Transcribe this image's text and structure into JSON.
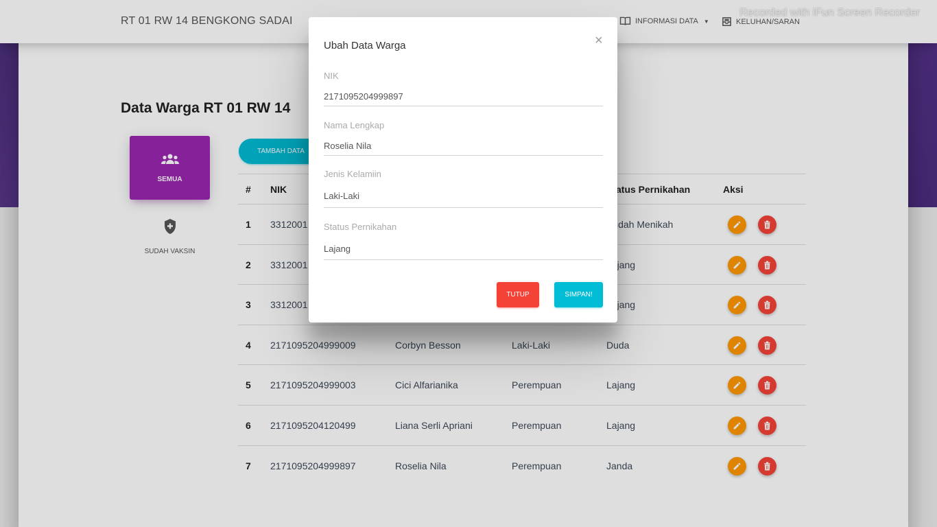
{
  "navbar": {
    "brand": "RT 01 RW 14 BENGKONG SADAI",
    "informasi": "INFORMASI DATA",
    "keluhan": "KELUHAN/SARAN",
    "watermark": "Recorded with iFun Screen Recorder"
  },
  "page": {
    "title": "Data Warga RT 01 RW 14"
  },
  "sidebar": {
    "semua": "SEMUA",
    "vaksin": "SUDAH VAKSIN"
  },
  "toolbar": {
    "tambah": "TAMBAH DATA"
  },
  "table": {
    "headers": [
      "#",
      "NIK",
      "",
      "",
      "Status Pernikahan",
      "Aksi"
    ],
    "rows": [
      {
        "no": "1",
        "nik": "3312001",
        "nama": "",
        "jk": "",
        "status": "Sudah Menikah"
      },
      {
        "no": "2",
        "nik": "3312001",
        "nama": "",
        "jk": "",
        "status": "Lajang"
      },
      {
        "no": "3",
        "nik": "3312001",
        "nama": "",
        "jk": "",
        "status": "Lajang"
      },
      {
        "no": "4",
        "nik": "2171095204999009",
        "nama": "Corbyn Besson",
        "jk": "Laki-Laki",
        "status": "Duda"
      },
      {
        "no": "5",
        "nik": "2171095204999003",
        "nama": "Cici Alfarianika",
        "jk": "Perempuan",
        "status": "Lajang"
      },
      {
        "no": "6",
        "nik": "2171095204120499",
        "nama": "Liana Serli Apriani",
        "jk": "Perempuan",
        "status": "Lajang"
      },
      {
        "no": "7",
        "nik": "2171095204999897",
        "nama": "Roselia Nila",
        "jk": "Perempuan",
        "status": "Janda"
      }
    ]
  },
  "modal": {
    "title": "Ubah Data Warga",
    "close": "×",
    "fields": [
      {
        "label": "NIK",
        "value": "2171095204999897"
      },
      {
        "label": "Nama Lengkap",
        "value": "Roselia Nila"
      },
      {
        "label": "Jenis Kelamiin",
        "value": "Laki-Laki"
      },
      {
        "label": "Status Pernikahan",
        "value": "Lajang"
      }
    ],
    "tutup": "TUTUP",
    "simpan": "SIMPAN!"
  },
  "colors": {
    "primary": "#9c27b0",
    "info": "#00bcd4",
    "warning": "#ff9800",
    "danger": "#f44336"
  }
}
